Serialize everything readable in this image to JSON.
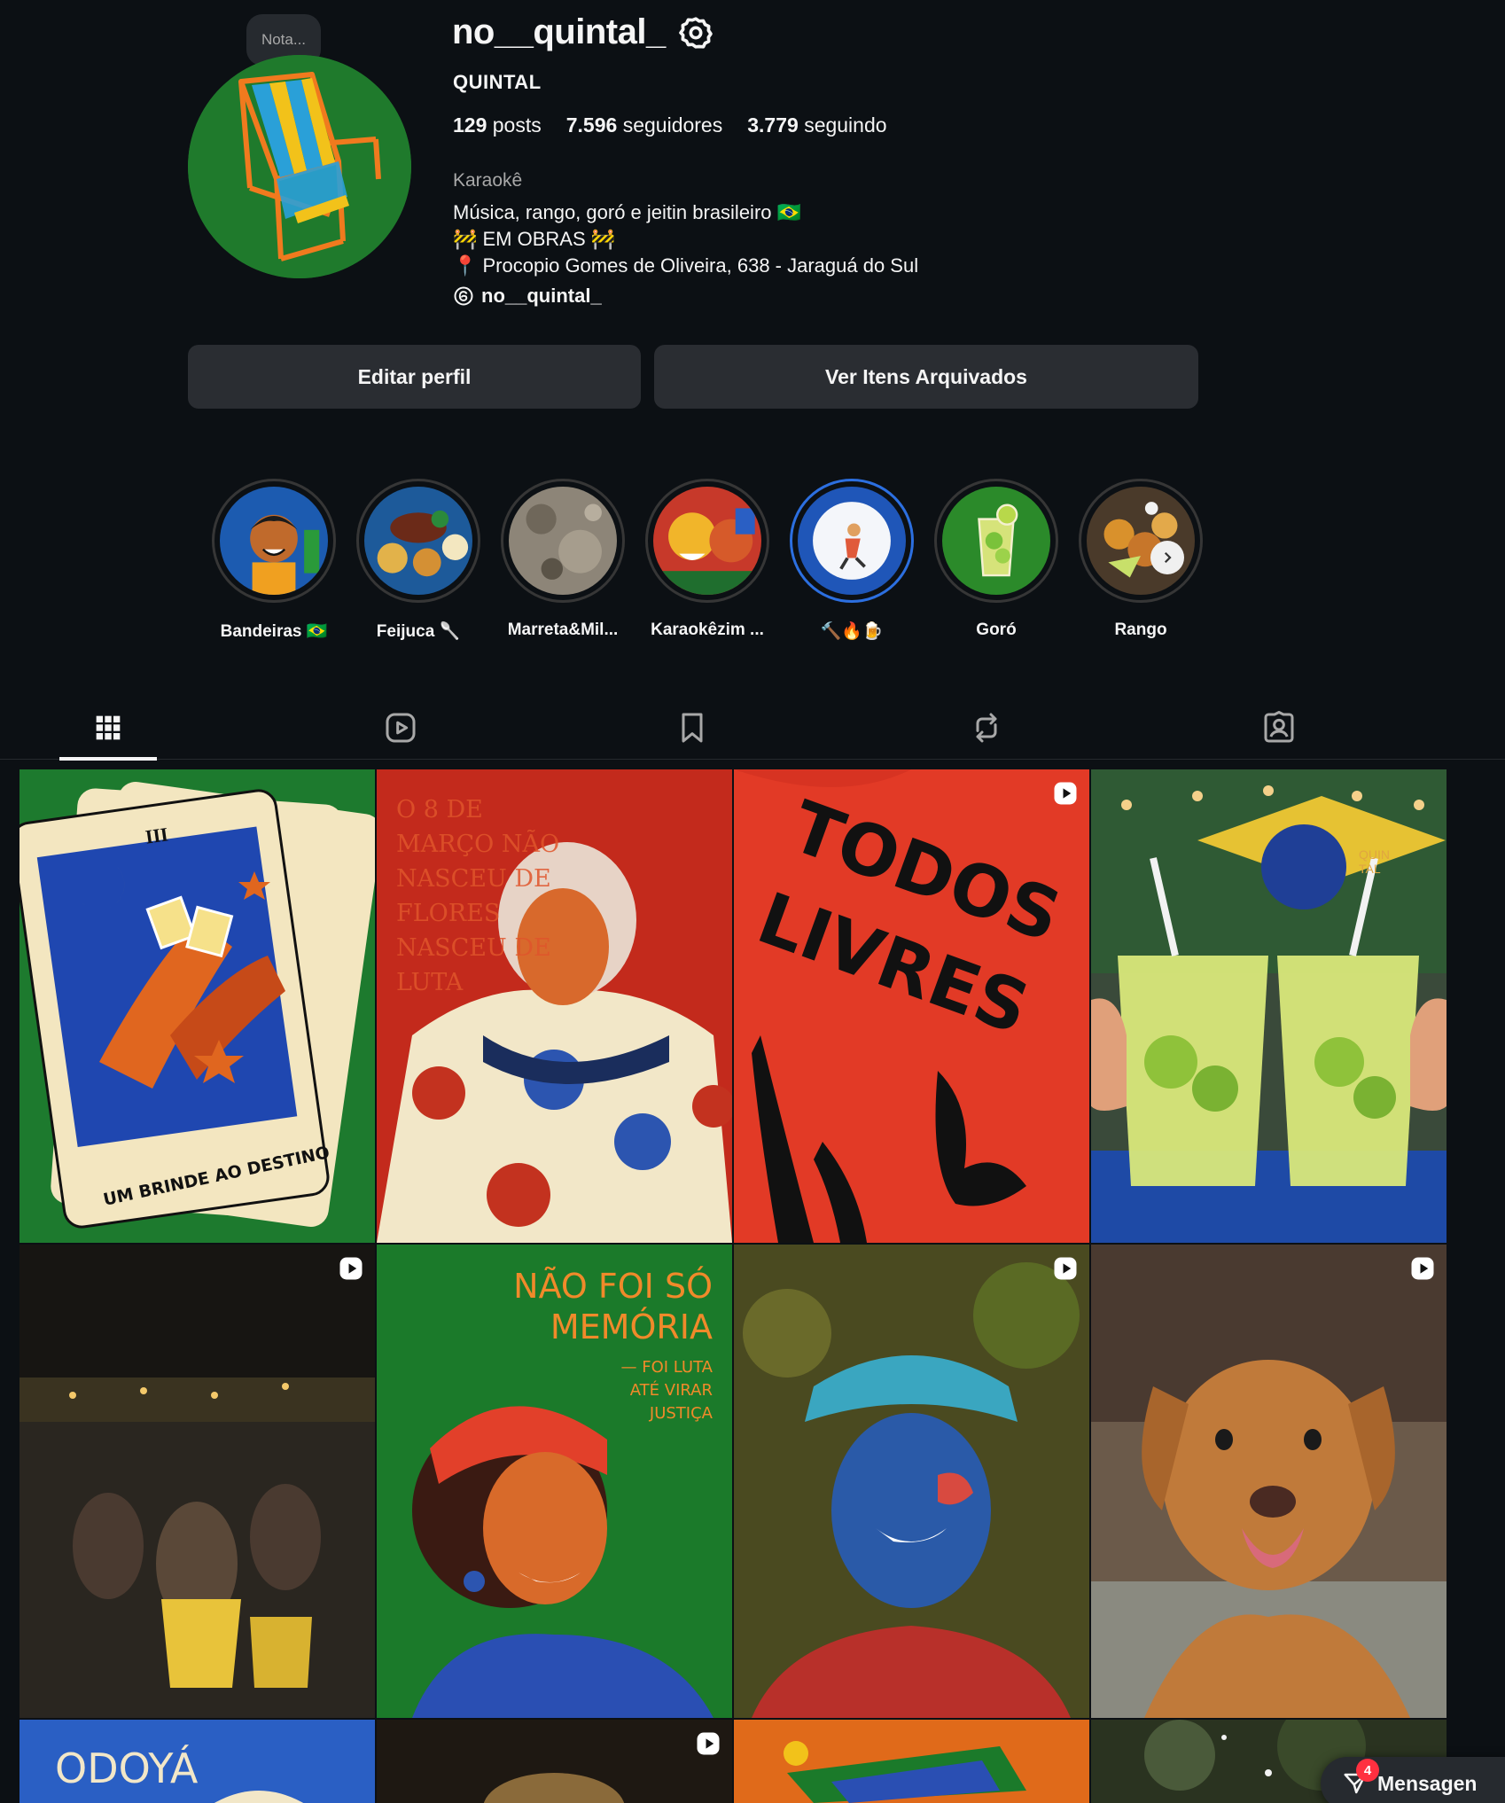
{
  "profile": {
    "note": "Nota...",
    "username": "no__quintal_",
    "display_name": "QUINTAL",
    "stats": {
      "posts_count": "129",
      "posts_label": "posts",
      "followers_count": "7.596",
      "followers_label": "seguidores",
      "following_count": "3.779",
      "following_label": "seguindo"
    },
    "category": "Karaokê",
    "bio": {
      "line1": "Música, rango, goró e jeitin brasileiro 🇧🇷",
      "line2": "🚧 EM OBRAS 🚧",
      "line3": "📍 Procopio Gomes de Oliveira, 638 - Jaraguá do Sul"
    },
    "threads_handle": "no__quintal_"
  },
  "buttons": {
    "edit_profile": "Editar perfil",
    "archive": "Ver Itens Arquivados"
  },
  "highlights": [
    {
      "label": "Bandeiras 🇧🇷"
    },
    {
      "label": "Feijuca 🥄"
    },
    {
      "label": "Marreta&Mil..."
    },
    {
      "label": "Karaokêzim ..."
    },
    {
      "label": "🔨🔥🍺"
    },
    {
      "label": "Goró"
    },
    {
      "label": "Rango"
    }
  ],
  "tabs": [
    "posts-grid",
    "reels",
    "saved",
    "reposts",
    "tagged"
  ],
  "posts": [
    {
      "text": "UM BRINDE AO DESTINO",
      "numeral": "III",
      "reel": false
    },
    {
      "text": "O 8 DE MARÇO NÃO NASCEU DE FLORES NASCEU DE LUTA",
      "reel": false
    },
    {
      "text": "TODOS LIVRES",
      "reel": true
    },
    {
      "text": "QUIN TAL",
      "reel": false
    },
    {
      "reel": true
    },
    {
      "text_main": "NÃO FOI SÓ MEMÓRIA",
      "text_sub": "— FOI LUTA ATÉ VIRAR JUSTIÇA",
      "reel": false
    },
    {
      "reel": true
    },
    {
      "reel": true
    },
    {
      "text": "ODOYÁ",
      "reel": false
    },
    {
      "reel": true
    },
    {
      "reel": false
    },
    {
      "reel": false
    }
  ],
  "messages": {
    "label": "Mensagen",
    "badge": "4"
  }
}
